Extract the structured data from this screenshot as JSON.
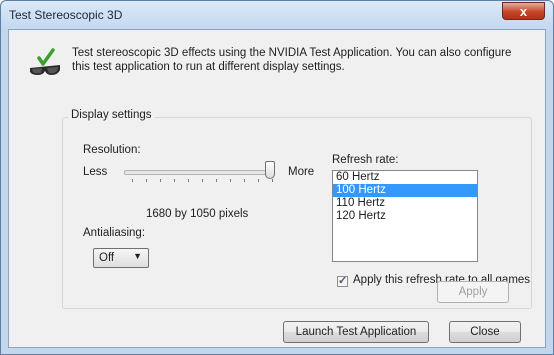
{
  "window": {
    "title": "Test Stereoscopic 3D",
    "close_label": "x"
  },
  "description": "Test stereoscopic 3D effects using the NVIDIA Test Application. You can also configure this test application to run at different display settings.",
  "display_settings": {
    "group_label": "Display settings",
    "resolution_label": "Resolution:",
    "slider_min_label": "Less",
    "slider_max_label": "More",
    "resolution_value": "1680 by 1050 pixels",
    "slider_level": 1.0,
    "antialiasing_label": "Antialiasing:",
    "antialiasing_value": "Off",
    "refresh_rate_label": "Refresh rate:",
    "refresh_rates": [
      "60 Hertz",
      "100 Hertz",
      "110 Hertz",
      "120 Hertz"
    ],
    "selected_refresh_rate": "100 Hertz",
    "apply_all_label": "Apply this refresh rate to all games",
    "apply_all_checked": true,
    "apply_button": "Apply"
  },
  "buttons": {
    "launch": "Launch Test Application",
    "close": "Close"
  }
}
